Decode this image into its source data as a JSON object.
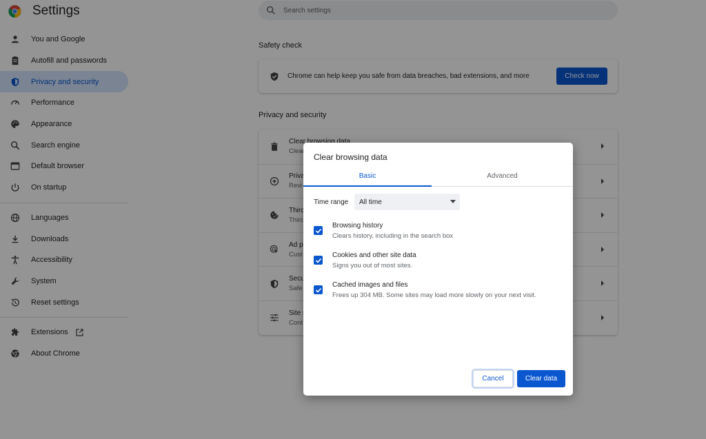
{
  "app": {
    "title": "Settings"
  },
  "search": {
    "placeholder": "Search settings"
  },
  "sidebar": {
    "items": [
      {
        "label": "You and Google"
      },
      {
        "label": "Autofill and passwords"
      },
      {
        "label": "Privacy and security"
      },
      {
        "label": "Performance"
      },
      {
        "label": "Appearance"
      },
      {
        "label": "Search engine"
      },
      {
        "label": "Default browser"
      },
      {
        "label": "On startup"
      },
      {
        "label": "Languages"
      },
      {
        "label": "Downloads"
      },
      {
        "label": "Accessibility"
      },
      {
        "label": "System"
      },
      {
        "label": "Reset settings"
      },
      {
        "label": "Extensions"
      },
      {
        "label": "About Chrome"
      }
    ],
    "active": "Privacy and security"
  },
  "safety_check": {
    "title": "Safety check",
    "text": "Chrome can help keep you safe from data breaches, bad extensions, and more",
    "button": "Check now"
  },
  "privacy": {
    "title": "Privacy and security",
    "rows": [
      {
        "title": "Clear browsing data",
        "subtitle": "Clear"
      },
      {
        "title": "Priva",
        "subtitle": "Revi"
      },
      {
        "title": "Thirc",
        "subtitle": "Thirc"
      },
      {
        "title": "Ad p",
        "subtitle": "Cust"
      },
      {
        "title": "Secu",
        "subtitle": "Safe"
      },
      {
        "title": "Site s",
        "subtitle": "Cont"
      }
    ]
  },
  "dialog": {
    "title": "Clear browsing data",
    "tabs": {
      "basic": "Basic",
      "advanced": "Advanced"
    },
    "time_range_label": "Time range",
    "time_range_value": "All time",
    "options": [
      {
        "title": "Browsing history",
        "subtitle": "Clears history, including in the search box",
        "checked": true
      },
      {
        "title": "Cookies and other site data",
        "subtitle": "Signs you out of most sites.",
        "checked": true
      },
      {
        "title": "Cached images and files",
        "subtitle": "Frees up 304 MB. Some sites may load more slowly on your next visit.",
        "checked": true
      }
    ],
    "cancel": "Cancel",
    "confirm": "Clear data"
  },
  "colors": {
    "accent": "#0b57d0",
    "active_nav_bg": "#d3e3fd"
  }
}
